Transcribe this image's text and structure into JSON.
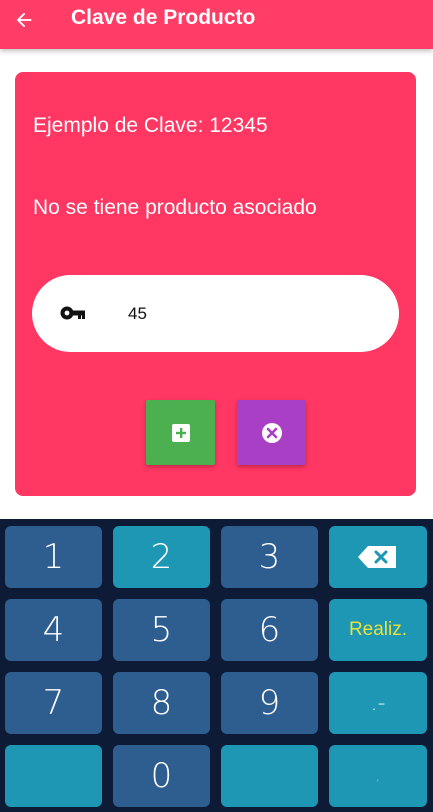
{
  "appbar": {
    "title": "Clave de Producto",
    "back_icon": "arrow-left-icon"
  },
  "card": {
    "example_text": "Ejemplo de Clave: 12345",
    "status_text": "No se tiene producto asociado",
    "input_value": "45",
    "key_icon": "key-icon",
    "add_icon": "plus-box-icon",
    "cancel_icon": "close-circle-icon"
  },
  "keyboard": {
    "k1": "1",
    "k2": "2",
    "k3": "3",
    "k4": "4",
    "k5": "5",
    "k6": "6",
    "k7": "7",
    "k8": "8",
    "k9": "9",
    "k0": "0",
    "done": "Realiz.",
    "dot_dash": ".-",
    "comma": ","
  },
  "colors": {
    "appbar": "#ff3d66",
    "card": "#ff3762",
    "add_button": "#4caf50",
    "cancel_button": "#a93fc5",
    "keyboard_bg": "#0e1b37",
    "key_dark": "#2e5e90",
    "key_light": "#1e97b5",
    "done_text": "#e8e23a"
  }
}
